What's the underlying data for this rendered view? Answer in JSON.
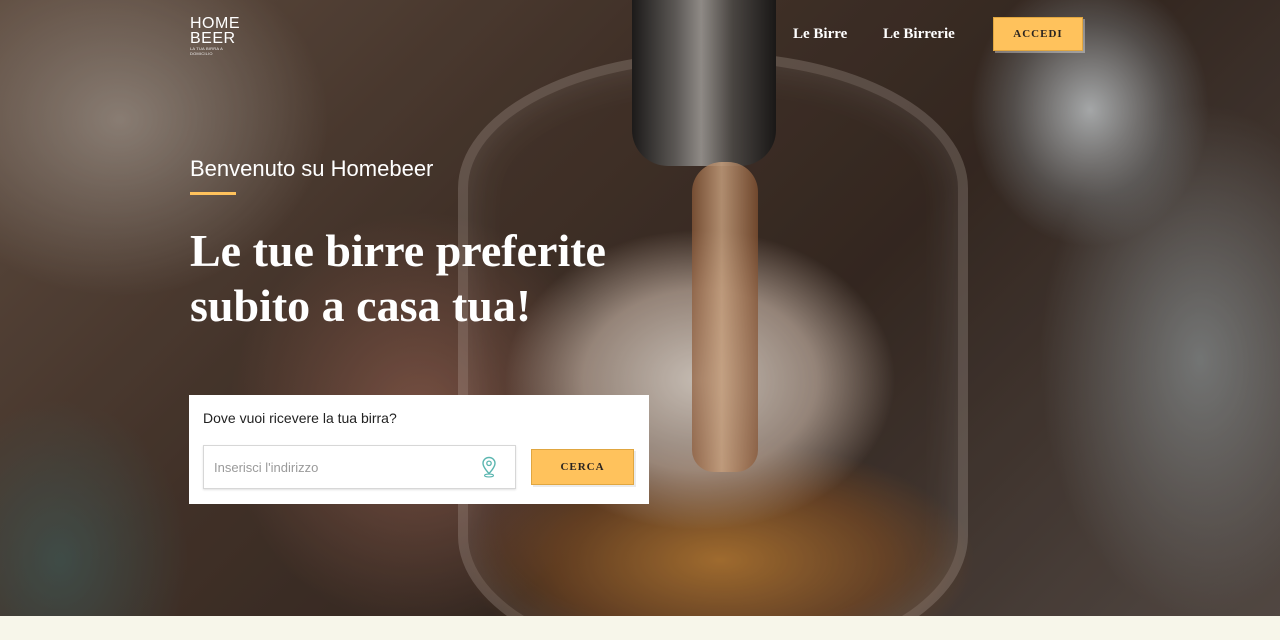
{
  "brand": {
    "logo_line1": "HOME",
    "logo_line2": "BEER",
    "logo_tagline": "LA TUA BIRRA A DOMICILIO"
  },
  "nav": {
    "links": [
      "Le Birre",
      "Le Birrerie"
    ],
    "login_label": "ACCEDI"
  },
  "hero": {
    "welcome": "Benvenuto su Homebeer",
    "headline_line1": "Le tue birre preferite",
    "headline_line2": "subito a casa tua!"
  },
  "search": {
    "label": "Dove vuoi ricevere la tua birra?",
    "placeholder": "Inserisci l'indirizzo",
    "value": "",
    "location_icon": "map-pin-icon",
    "button_label": "CERCA"
  },
  "colors": {
    "accent": "#ffc25c",
    "footer_background": "#f7f6ea"
  }
}
